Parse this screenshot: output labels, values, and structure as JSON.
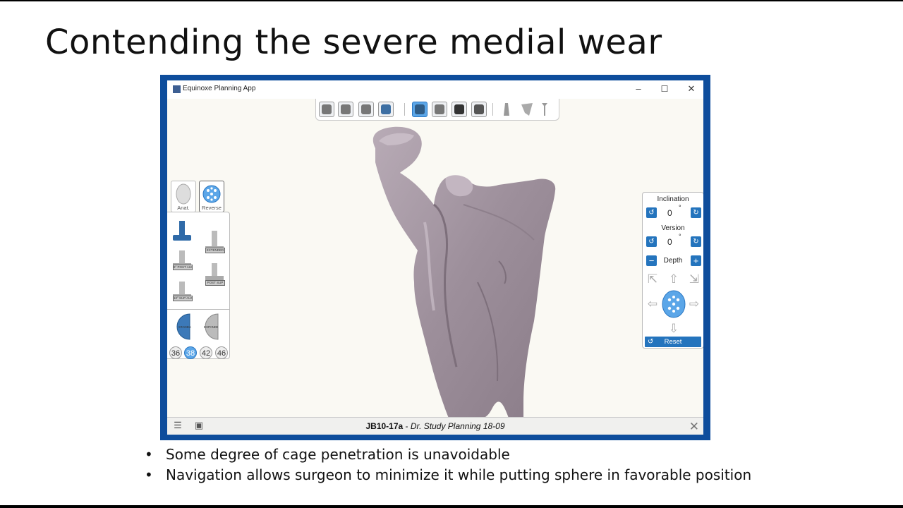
{
  "slide": {
    "title": "Contending the severe medial wear",
    "bullets": [
      "Some degree of cage penetration is unavoidable",
      "Navigation allows surgeon to minimize it while putting sphere in favorable position"
    ],
    "bullet_char": "•"
  },
  "app": {
    "window_title": "Equinoxe Planning App",
    "controls": {
      "minimize": "–",
      "maximize": "☐",
      "close": "✕"
    },
    "toolbar_icons": [
      "glenoid-view-icon",
      "implant-view-icon",
      "bone-scan-view-icon",
      "shaded-bone-icon",
      "scapula-front-icon",
      "scapula-side-icon",
      "scapula-dark-icon",
      "scapula-cut-icon",
      "scapula-outline-icon",
      "humerus-outline-icon",
      "humerus-stem-icon"
    ],
    "implant_tabs": {
      "anatomic_label": "Anat.",
      "reverse_label": "Reverse"
    },
    "stem_labels": [
      "EXTENDED",
      "8° POST AUG",
      "POST SUP",
      "10° SUP AUG"
    ],
    "glenosphere_labels": [
      "STANDARD",
      "EXPANDED"
    ],
    "sizes": [
      "36",
      "38",
      "42",
      "46"
    ],
    "selected_size": "38",
    "controls_panel": {
      "inclination_label": "Inclination",
      "inclination_value": "0",
      "version_label": "Version",
      "version_value": "0",
      "degree_symbol": "°",
      "depth_label": "Depth",
      "depth_minus": "−",
      "depth_plus": "+",
      "reset_label": "Reset",
      "reset_icon": "↺",
      "arrows": {
        "up_left": "⇱",
        "up": "⇧",
        "up_right": "⇲",
        "left": "⇦",
        "right": "⇨",
        "down": "⇩"
      }
    },
    "status": {
      "case_id": "JB10-17a",
      "separator": " - ",
      "case_desc": "Dr. Study Planning 18-09",
      "menu_icon": "☰",
      "save_icon": "▣",
      "close_icon": "✕"
    },
    "colors": {
      "frame": "#0e4d9c",
      "accent": "#2474bd",
      "bone": "#a89aa5"
    }
  }
}
